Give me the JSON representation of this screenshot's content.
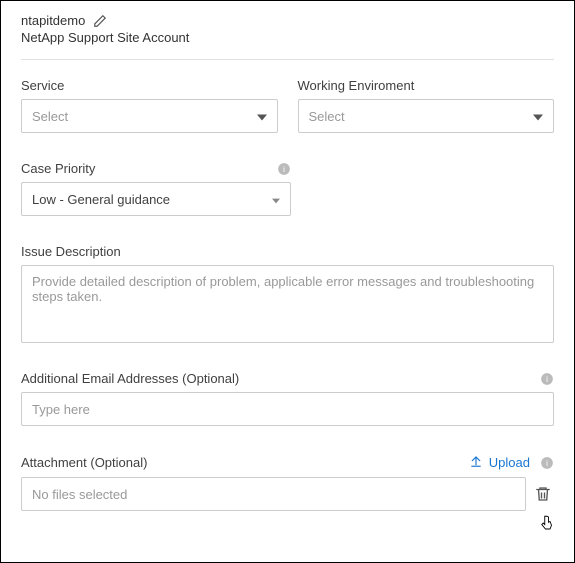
{
  "header": {
    "account_name": "ntapitdemo",
    "subtitle": "NetApp Support Site Account"
  },
  "fields": {
    "service": {
      "label": "Service",
      "placeholder": "Select"
    },
    "working_environment": {
      "label": "Working Enviroment",
      "placeholder": "Select"
    },
    "case_priority": {
      "label": "Case Priority",
      "value": "Low - General guidance"
    },
    "issue_description": {
      "label": "Issue Description",
      "placeholder": "Provide detailed description of problem, applicable error messages and troubleshooting steps taken."
    },
    "additional_emails": {
      "label": "Additional Email Addresses (Optional)",
      "placeholder": "Type here"
    },
    "attachment": {
      "label": "Attachment (Optional)",
      "upload_label": "Upload",
      "no_files": "No files selected"
    }
  }
}
